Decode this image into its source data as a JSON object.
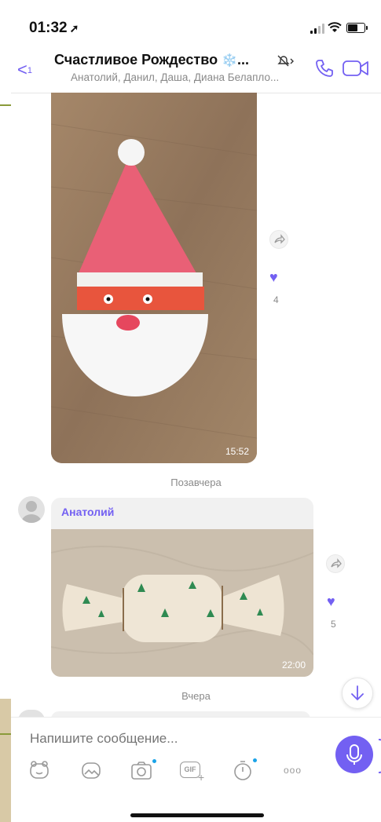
{
  "status_bar": {
    "time": "01:32",
    "location_icon": "location-arrow-icon",
    "signal_icon": "cellular-signal-icon",
    "wifi_icon": "wifi-icon",
    "battery_icon": "battery-icon"
  },
  "header": {
    "back_count": "1",
    "title": "Счастливое Рождество",
    "title_emoji": "❄️",
    "title_ellipsis": "...",
    "subtitle": "Анатолий, Данил, Даша, Диана Белапло...",
    "mute_icon": "muted-bell-icon",
    "call_icon": "phone-icon",
    "video_icon": "video-camera-icon"
  },
  "messages": [
    {
      "type": "image",
      "description_icon": "santa-craft-photo",
      "time": "15:52",
      "likes": "4"
    },
    {
      "type": "image",
      "sender": "Анатолий",
      "description_icon": "candy-craft-photo",
      "time": "22:00",
      "likes": "5"
    }
  ],
  "date_separators": {
    "first": "Позавчера",
    "second": "Вчера"
  },
  "composer": {
    "placeholder": "Напишите сообщение...",
    "tools": [
      "sticker-icon",
      "gallery-icon",
      "camera-icon",
      "gif-icon",
      "timer-icon",
      "more-icon"
    ],
    "gif_label": "GIF",
    "more_label": "ooo"
  },
  "colors": {
    "accent": "#7360f2",
    "bubble": "#f1f1f1",
    "meta_text": "#8a8a8a",
    "dot_blue": "#1aa3e8"
  }
}
